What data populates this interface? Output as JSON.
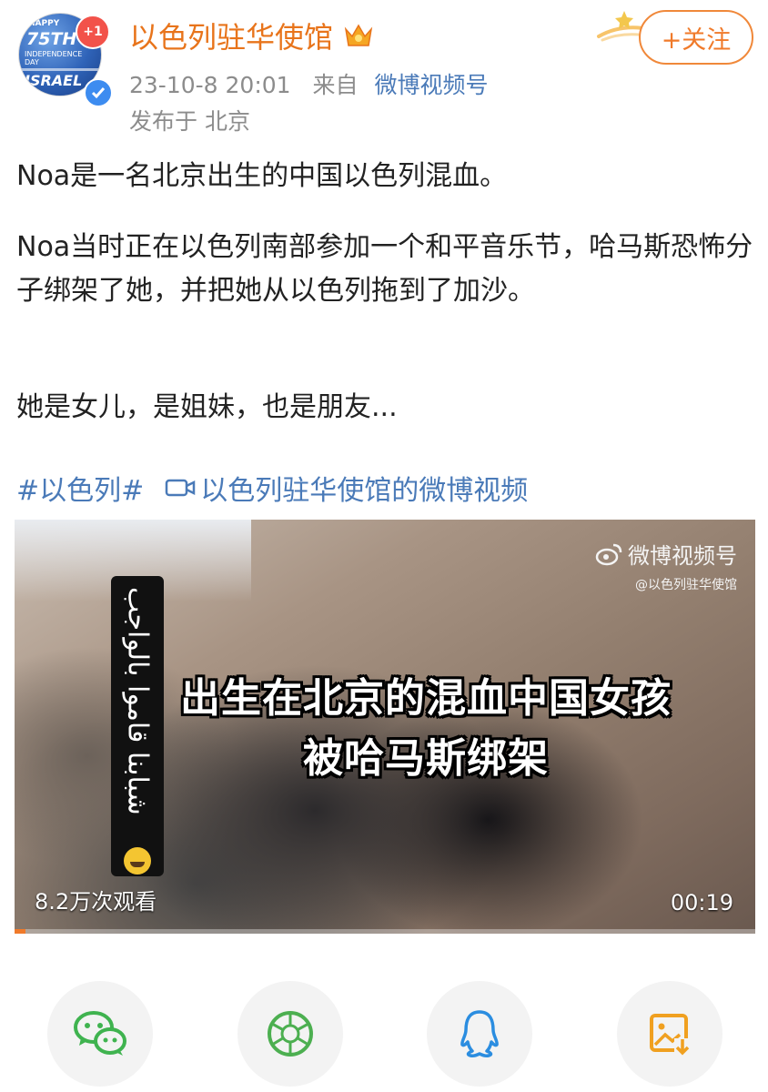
{
  "header": {
    "avatar": {
      "line1": "HAPPY",
      "line2": "75TH",
      "line3": "INDEPENDENCE DAY",
      "line4": "ISRAEL"
    },
    "badge_count": "+1",
    "account_name": "以色列驻华使馆",
    "timestamp": "23-10-8 20:01",
    "source_prefix": "来自",
    "source": "微博视频号",
    "location": "发布于 北京",
    "follow_label": "+关注"
  },
  "post": {
    "paragraph_1": "Noa是一名北京出生的中国以色列混血。",
    "paragraph_2": "Noa当时正在以色列南部参加一个和平音乐节，哈马斯恐怖分子绑架了她，并把她从以色列拖到了加沙。",
    "paragraph_3": "她是女儿，是姐妹，也是朋友...",
    "hashtag": "#以色列#",
    "video_link": "以色列驻华使馆的微博视频"
  },
  "video": {
    "arabic_overlay": "شبابنا قاموا بالواجب",
    "watermark_brand": "微博视频号",
    "watermark_handle": "@以色列驻华使馆",
    "caption_line_1": "出生在北京的混血中国女孩",
    "caption_line_2": "被哈马斯绑架",
    "views": "8.2万次观看",
    "duration": "00:19",
    "progress_fraction": 0.015
  },
  "share": [
    {
      "icon": "wechat-icon",
      "color": "#3fb34f"
    },
    {
      "icon": "moments-icon",
      "color": "#4caf50"
    },
    {
      "icon": "qq-icon",
      "color": "#2b8de0"
    },
    {
      "icon": "save-image-icon",
      "color": "#f0a020"
    }
  ],
  "colors": {
    "accent_orange": "#e8741b",
    "link_blue": "#4a7ab8",
    "meta_gray": "#8c8c8c"
  }
}
